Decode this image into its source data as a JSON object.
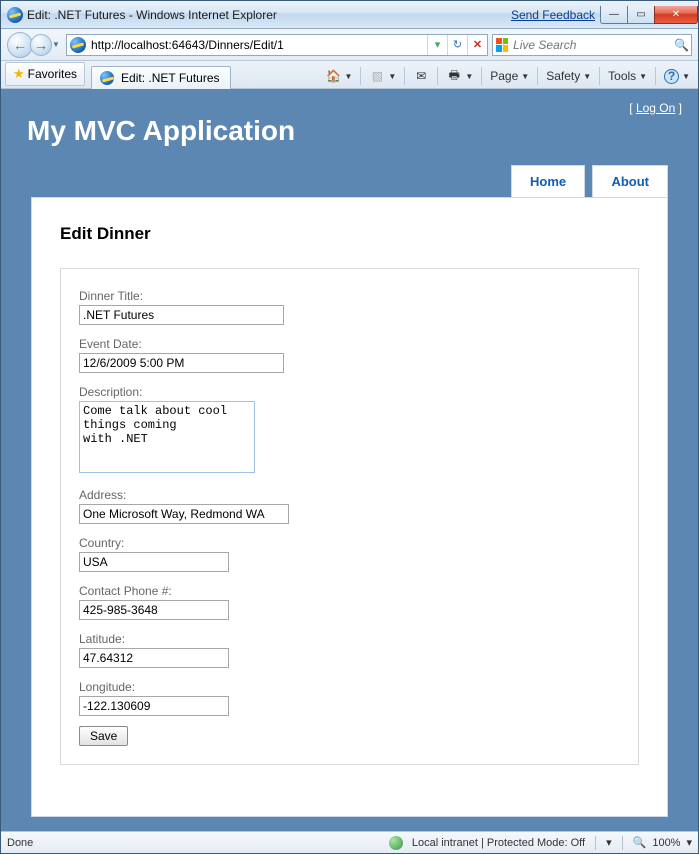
{
  "window": {
    "title": "Edit: .NET Futures - Windows Internet Explorer",
    "send_feedback": "Send Feedback"
  },
  "nav": {
    "url": "http://localhost:64643/Dinners/Edit/1",
    "search_placeholder": "Live Search"
  },
  "tabs": {
    "favorites": "Favorites",
    "active": "Edit: .NET Futures"
  },
  "toolbar": {
    "page": "Page",
    "safety": "Safety",
    "tools": "Tools"
  },
  "app": {
    "logon": "Log On",
    "title": "My MVC Application",
    "nav_home": "Home",
    "nav_about": "About"
  },
  "form": {
    "heading": "Edit Dinner",
    "dinner_title_label": "Dinner Title:",
    "dinner_title": ".NET Futures",
    "event_date_label": "Event Date:",
    "event_date": "12/6/2009 5:00 PM",
    "description_label": "Description:",
    "description": "Come talk about cool things coming\nwith .NET",
    "address_label": "Address:",
    "address": "One Microsoft Way, Redmond WA",
    "country_label": "Country:",
    "country": "USA",
    "phone_label": "Contact Phone #:",
    "phone": "425-985-3648",
    "lat_label": "Latitude:",
    "lat": "47.64312",
    "lon_label": "Longitude:",
    "lon": "-122.130609",
    "save": "Save"
  },
  "status": {
    "left": "Done",
    "zone": "Local intranet | Protected Mode: Off",
    "zoom": "100%"
  }
}
